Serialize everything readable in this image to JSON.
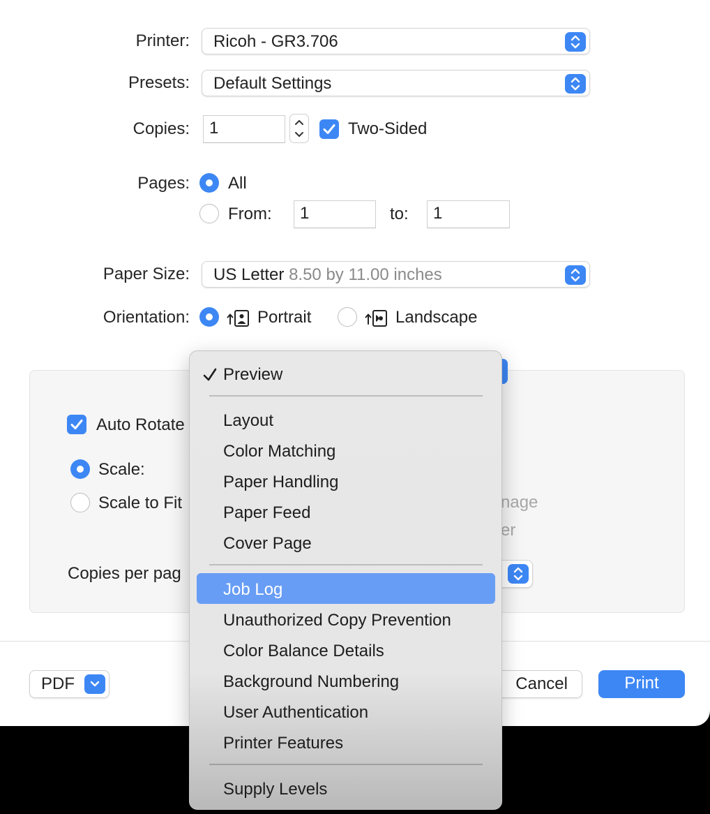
{
  "printer": {
    "label": "Printer:",
    "value": "Ricoh - GR3.706"
  },
  "presets": {
    "label": "Presets:",
    "value": "Default Settings"
  },
  "copies": {
    "label": "Copies:",
    "value": "1",
    "two_sided_label": "Two-Sided",
    "two_sided_checked": true
  },
  "pages": {
    "label": "Pages:",
    "all_label": "All",
    "from_label": "From:",
    "from_value": "1",
    "to_label": "to:",
    "to_value": "1",
    "selected": "All"
  },
  "paper_size": {
    "label": "Paper Size:",
    "value": "US Letter",
    "detail": "8.50 by 11.00 inches"
  },
  "orientation": {
    "label": "Orientation:",
    "portrait_label": "Portrait",
    "landscape_label": "Landscape",
    "selected": "Portrait"
  },
  "panel": {
    "auto_rotate_label": "Auto Rotate",
    "scale_label": "Scale:",
    "scale_to_fit_label": "Scale to Fit",
    "hidden_right_1": "nage",
    "hidden_right_2": "er",
    "copies_per_page_label": "Copies per pag"
  },
  "footer": {
    "pdf_label": "PDF",
    "cancel_label": "Cancel",
    "print_label": "Print"
  },
  "menu": {
    "checked_item": "Preview",
    "group1": [
      "Layout",
      "Color Matching",
      "Paper Handling",
      "Paper Feed",
      "Cover Page"
    ],
    "group2": [
      "Job Log",
      "Unauthorized Copy Prevention",
      "Color Balance Details",
      "Background Numbering",
      "User Authentication",
      "Printer Features"
    ],
    "group3": [
      "Supply Levels"
    ],
    "highlighted": "Job Log"
  },
  "colors": {
    "accent": "#3d87f5",
    "highlight": "#689df5"
  }
}
